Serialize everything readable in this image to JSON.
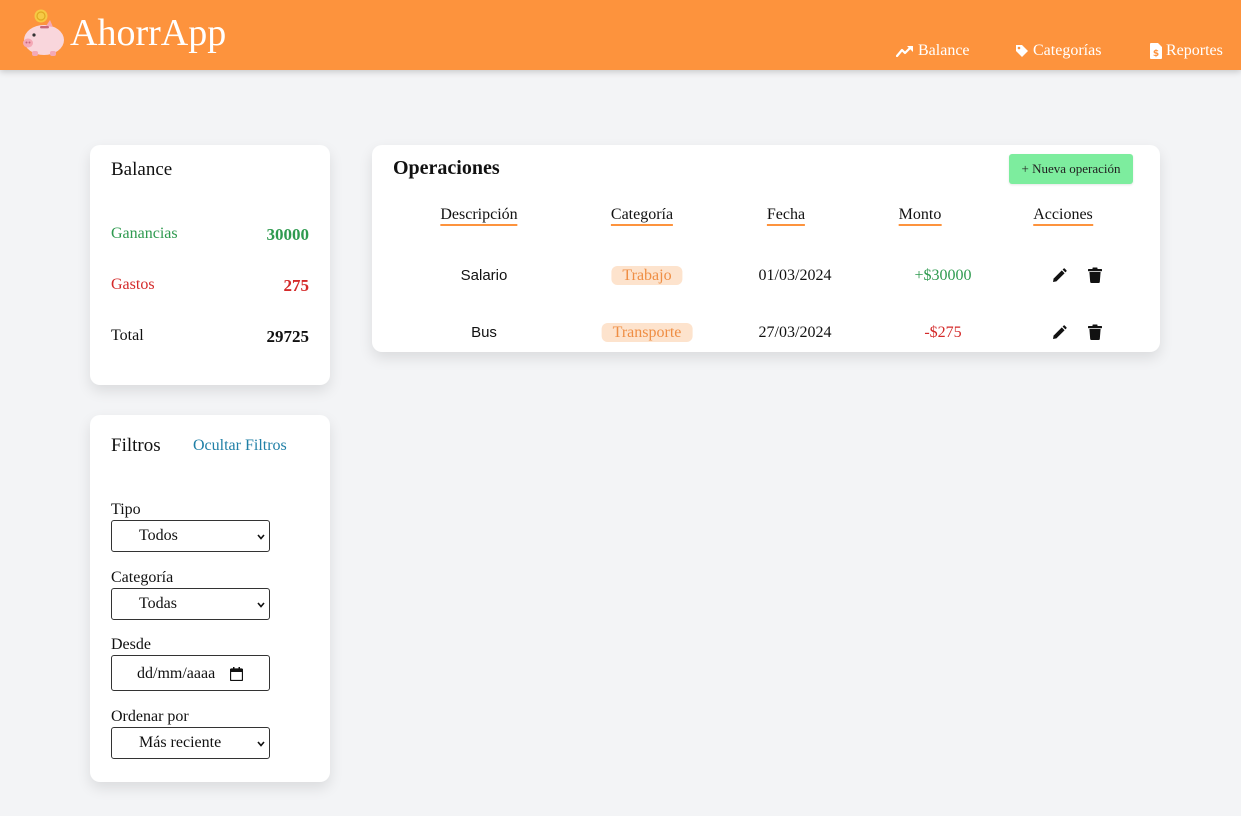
{
  "app": {
    "title": "AhorrApp"
  },
  "nav": [
    {
      "label": "Balance",
      "icon": "trending-up-icon"
    },
    {
      "label": "Categorías",
      "icon": "tag-icon"
    },
    {
      "label": "Reportes",
      "icon": "file-dollar-icon"
    }
  ],
  "balance": {
    "title": "Balance",
    "ganancias_label": "Ganancias",
    "ganancias_value": "30000",
    "gastos_label": "Gastos",
    "gastos_value": "275",
    "total_label": "Total",
    "total_value": "29725"
  },
  "filters": {
    "title": "Filtros",
    "hide_link": "Ocultar Filtros",
    "tipo_label": "Tipo",
    "tipo_value": "Todos",
    "categoria_label": "Categoría",
    "categoria_value": "Todas",
    "desde_label": "Desde",
    "desde_value": "dd/mm/aaaa",
    "orden_label": "Ordenar por",
    "orden_value": "Más reciente"
  },
  "operations": {
    "title": "Operaciones",
    "new_button": "+ Nueva operación",
    "headers": [
      "Descripción",
      "Categoría",
      "Fecha",
      "Monto",
      "Acciones"
    ],
    "rows": [
      {
        "descripcion": "Salario",
        "categoria": "Trabajo",
        "fecha": "01/03/2024",
        "monto": "+$30000"
      },
      {
        "descripcion": "Bus",
        "categoria": "Transporte",
        "fecha": "27/03/2024",
        "monto": "-$275"
      }
    ]
  },
  "colors": {
    "header": "#fd933d",
    "income": "#2e9a4f",
    "expense": "#d42a2a",
    "new_button": "#7ded9e",
    "badge_bg": "#fde3cd",
    "badge_text": "#ef8e44",
    "link": "#1f7fa6"
  }
}
